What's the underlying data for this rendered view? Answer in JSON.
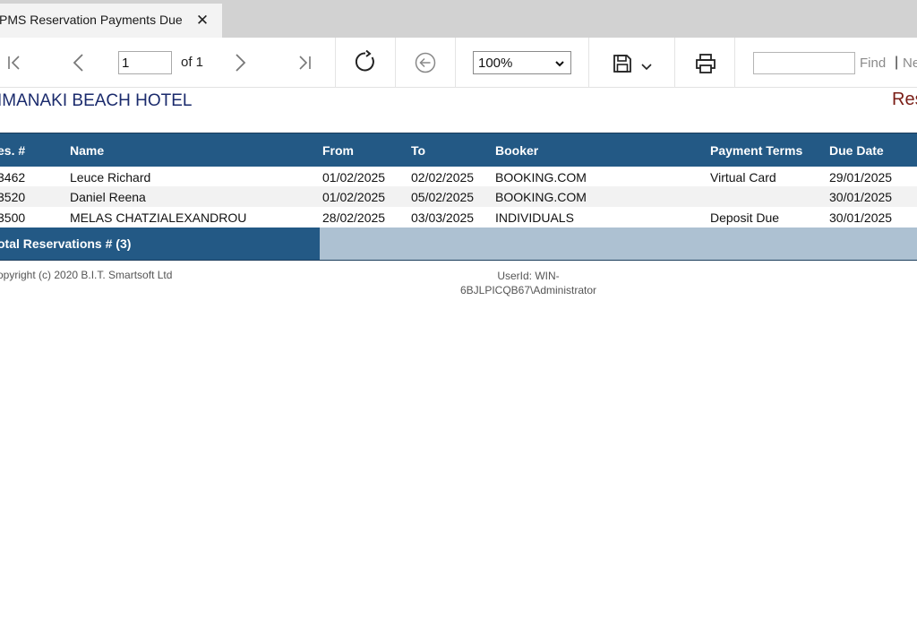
{
  "tab": {
    "title": "PMS Reservation Payments Due",
    "close_glyph": "✕"
  },
  "toolbar": {
    "page_value": "1",
    "of_label": "of 1",
    "zoom": "100%",
    "find_label": "Find",
    "separator": "|",
    "next_label": "Ne",
    "icons": [
      "first-page-icon",
      "prev-page-icon",
      "next-page-icon",
      "last-page-icon",
      "refresh-icon",
      "back-icon",
      "save-icon",
      "dropdown-chevron-icon",
      "print-icon"
    ]
  },
  "report": {
    "hotel": "IMANAKI BEACH HOTEL",
    "title_partial": "Res",
    "columns": [
      "es. #",
      "Name",
      "From",
      "To",
      "Booker",
      "Payment Terms",
      "Due Date"
    ],
    "rows": [
      {
        "res": "3462",
        "name": "Leuce Richard",
        "from": "01/02/2025",
        "to": "02/02/2025",
        "booker": "BOOKING.COM",
        "terms": "Virtual Card",
        "due": "29/01/2025"
      },
      {
        "res": "3520",
        "name": "Daniel Reena",
        "from": "01/02/2025",
        "to": "05/02/2025",
        "booker": "BOOKING.COM",
        "terms": "",
        "due": "30/01/2025"
      },
      {
        "res": "3500",
        "name": "MELAS CHATZIALEXANDROU",
        "from": "28/02/2025",
        "to": "03/03/2025",
        "booker": "INDIVIDUALS",
        "terms": "Deposit Due",
        "due": "30/01/2025"
      }
    ],
    "total": "otal Reservations # (3)",
    "copyright": "opyright (c) 2020 B.I.T. Smartsoft Ltd",
    "userid_line1": "UserId: WIN-",
    "userid_line2": "6BJLPICQB67\\Administrator"
  },
  "colors": {
    "header_bg": "#235985",
    "total_light": "#adc1d2",
    "hotel_text": "#1a2a6c",
    "title_text": "#7a1d16"
  }
}
